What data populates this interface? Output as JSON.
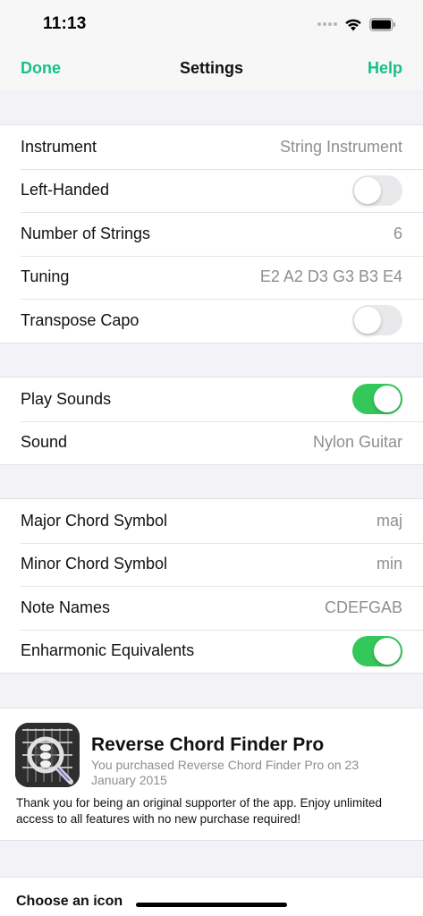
{
  "status_bar": {
    "time": "11:13",
    "icons": [
      "signal-icon",
      "wifi-icon",
      "battery-icon"
    ]
  },
  "nav": {
    "left_label": "Done",
    "title": "Settings",
    "right_label": "Help",
    "accent_color": "#19c089"
  },
  "instrument_group": {
    "rows": [
      {
        "label": "Instrument",
        "value": "String Instrument"
      },
      {
        "label": "Left-Handed",
        "toggle": false
      },
      {
        "label": "Number of Strings",
        "value": "6"
      },
      {
        "label": "Tuning",
        "value": "E2 A2 D3 G3 B3 E4"
      },
      {
        "label": "Transpose Capo",
        "toggle": false
      }
    ]
  },
  "sound_group": {
    "rows": [
      {
        "label": "Play Sounds",
        "toggle": true
      },
      {
        "label": "Sound",
        "value": "Nylon Guitar"
      }
    ]
  },
  "notation_group": {
    "rows": [
      {
        "label": "Major Chord Symbol",
        "value": "maj"
      },
      {
        "label": "Minor Chord Symbol",
        "value": "min"
      },
      {
        "label": "Note Names",
        "value": "CDEFGAB"
      },
      {
        "label": "Enharmonic Equivalents",
        "toggle": true
      }
    ]
  },
  "promo": {
    "title": "Reverse Chord Finder Pro",
    "subtitle": "You purchased Reverse Chord Finder Pro on 23 January 2015",
    "body": "Thank you for being an original supporter of the app. Enjoy unlimited access to all features with no new purchase required!"
  },
  "icon_section": {
    "label": "Choose an icon"
  },
  "colors": {
    "toggle_on": "#34c759",
    "toggle_off": "#e9e9eb",
    "secondary_text": "#8e8e93",
    "background": "#f2f2f7"
  }
}
